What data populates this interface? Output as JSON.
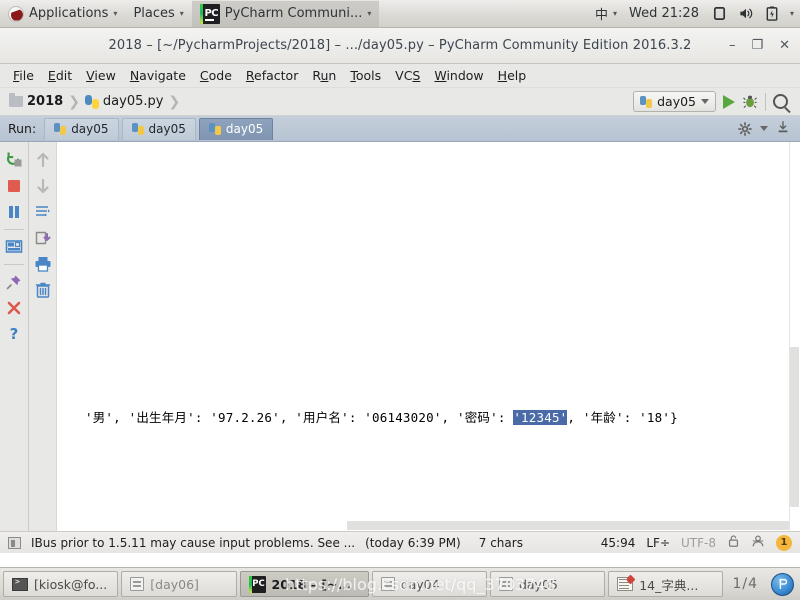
{
  "gnome_panel": {
    "logo": "fedora-logo",
    "applications": "Applications",
    "places": "Places",
    "window_title": "PyCharm Communi...",
    "caret": "▾",
    "input_method": "中",
    "clock": "Wed 21:28",
    "icons": [
      "display-icon",
      "volume-icon",
      "battery-icon"
    ]
  },
  "ide": {
    "title": "2018 – [~/PycharmProjects/2018] – .../day05.py – PyCharm Community Edition 2016.3.2",
    "window_buttons": {
      "minimize": "–",
      "maximize": "❐",
      "close": "✕"
    },
    "menu": [
      {
        "pre": "",
        "mn": "F",
        "post": "ile"
      },
      {
        "pre": "",
        "mn": "E",
        "post": "dit"
      },
      {
        "pre": "",
        "mn": "V",
        "post": "iew"
      },
      {
        "pre": "",
        "mn": "N",
        "post": "avigate"
      },
      {
        "pre": "",
        "mn": "C",
        "post": "ode"
      },
      {
        "pre": "",
        "mn": "R",
        "post": "efactor"
      },
      {
        "pre": "R",
        "mn": "u",
        "post": "n"
      },
      {
        "pre": "",
        "mn": "T",
        "post": "ools"
      },
      {
        "pre": "VC",
        "mn": "S",
        "post": ""
      },
      {
        "pre": "",
        "mn": "W",
        "post": "indow"
      },
      {
        "pre": "",
        "mn": "H",
        "post": "elp"
      }
    ],
    "breadcrumb": {
      "project": "2018",
      "file": "day05.py",
      "separator": "❯"
    },
    "toolbar": {
      "run_config": "day05",
      "run_config_caret": "▾",
      "run_button": "run-icon",
      "debug_button": "debug-icon",
      "search_button": "search-icon"
    },
    "run_window": {
      "label": "Run:",
      "tabs": [
        {
          "label": "day05",
          "active": false
        },
        {
          "label": "day05",
          "active": false
        },
        {
          "label": "day05",
          "active": true
        }
      ],
      "settings_icon": "gear-icon",
      "settings_caret": "▾",
      "hide_icon": "hide-icon"
    },
    "left_tools": [
      {
        "name": "rerun-icon"
      },
      {
        "name": "stop-icon"
      },
      {
        "name": "pause-icon"
      },
      {
        "name": "divider"
      },
      {
        "name": "layout-icon"
      },
      {
        "name": "divider"
      },
      {
        "name": "pin-icon"
      },
      {
        "name": "close-icon"
      },
      {
        "name": "help-icon"
      }
    ],
    "second_tools": [
      {
        "name": "up-arrow-icon"
      },
      {
        "name": "down-arrow-icon"
      },
      {
        "name": "soft-wrap-icon"
      },
      {
        "name": "export-icon"
      },
      {
        "name": "print-icon"
      },
      {
        "name": "trash-icon"
      }
    ],
    "console": {
      "text_before": "'男', '出生年月': '97.2.26', '用户名': '06143020', '密码': ",
      "selected_text": "'12345'",
      "text_after": ", '年龄': '18'}",
      "selection_color": "#4a6ba8"
    },
    "status_bar": {
      "message": "IBus prior to 1.5.11 may cause input problems. See ...",
      "timestamp": "(today 6:39 PM)",
      "chars": "7 chars",
      "position": "45:94",
      "line_ending": "LF÷",
      "encoding": "UTF-8",
      "lock_icon": "lock-icon",
      "user_icon": "user-icon",
      "badge": "1"
    }
  },
  "taskbar": {
    "items": [
      {
        "label": "[kiosk@fo...",
        "icon": "terminal-icon",
        "state": "normal"
      },
      {
        "label": "[day06]",
        "icon": "file-manager-icon",
        "state": "minimized"
      },
      {
        "label": "2018 – [~...",
        "icon": "pycharm-icon",
        "state": "active"
      },
      {
        "label": "day04",
        "icon": "file-manager-icon",
        "state": "normal"
      },
      {
        "label": "day05",
        "icon": "file-manager-icon",
        "state": "normal"
      },
      {
        "label": "14_字典...",
        "icon": "text-editor-icon",
        "state": "normal"
      }
    ],
    "workspace": "1/4",
    "tray_icon": "app-circle-icon"
  },
  "watermark": "https://blog.csdn.net/qq_3703748"
}
